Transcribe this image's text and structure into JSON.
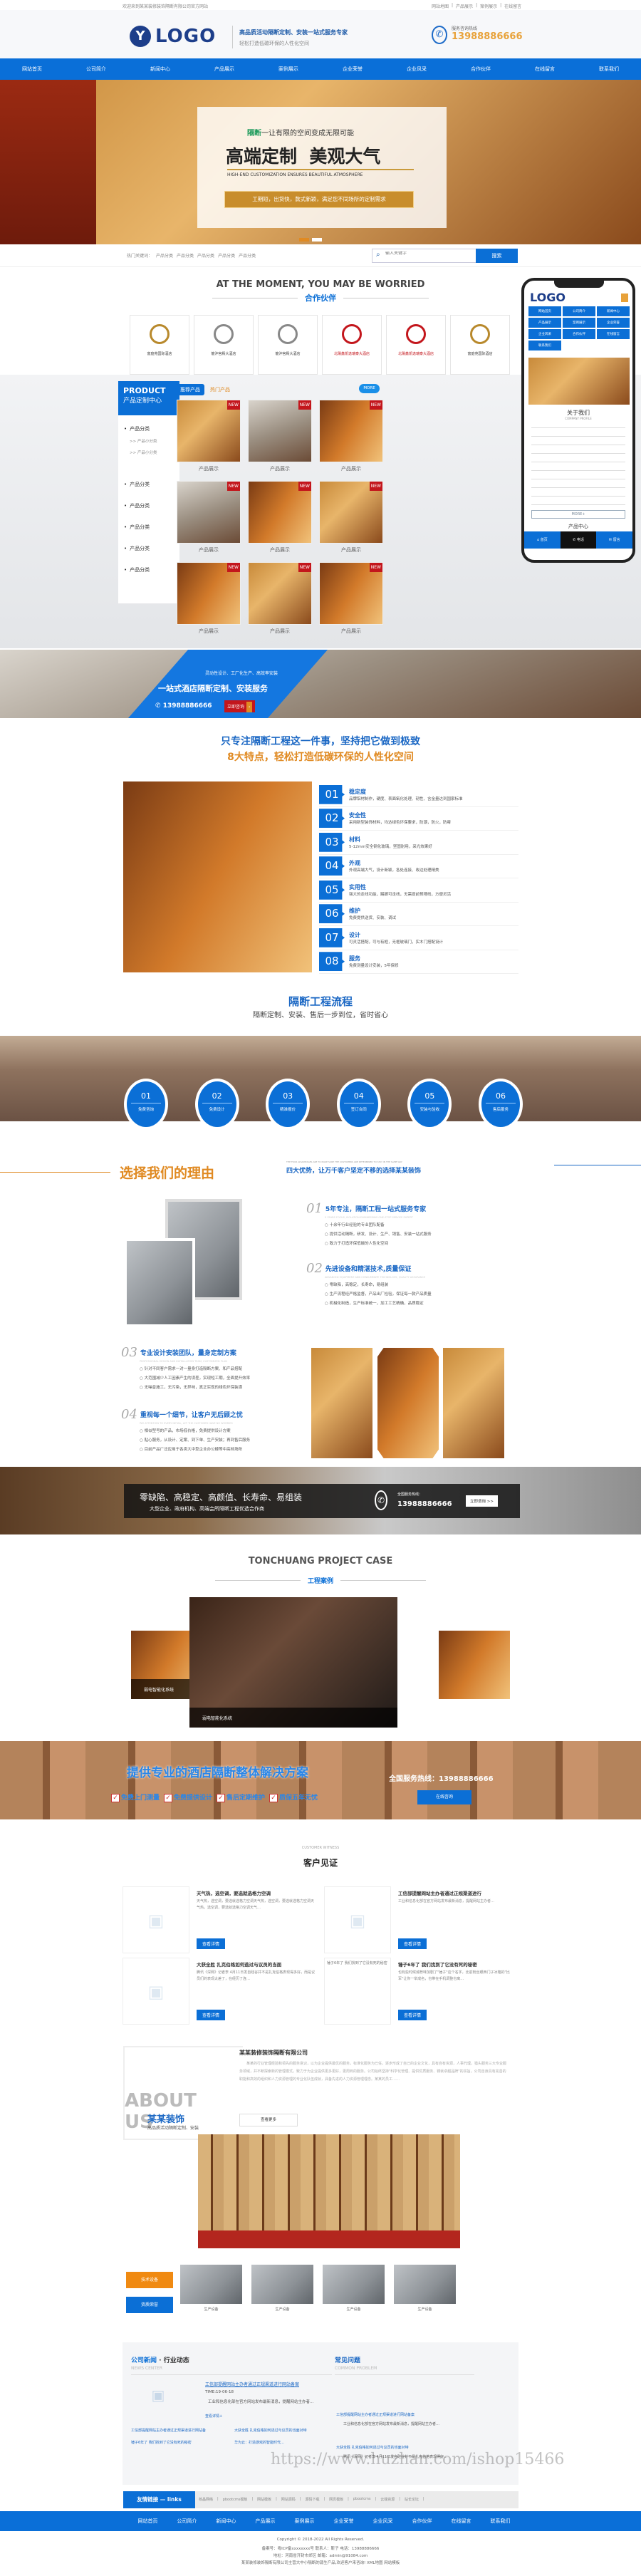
{
  "topbar": {
    "welcome": "欢迎来到某某装修装饰隔断有限公司官方网站",
    "links": [
      "网站地图",
      "产品展示",
      "案例展示",
      "在线留言"
    ]
  },
  "header": {
    "logo": "LOGO",
    "slogan": "高品质活动隔断定制、安装一站式服务专家",
    "sub": "轻松打造低碳环保的人性化空间",
    "hotline_label": "服务咨询热线",
    "phone": "13988886666"
  },
  "nav": [
    "网站首页",
    "公司简介",
    "新闻中心",
    "产品展示",
    "案例展示",
    "企业荣誉",
    "企业风采",
    "合作伙伴",
    "在线留言",
    "联系我们"
  ],
  "banner": {
    "kicker_em": "隔断",
    "kicker": "一让有限的空间变成无限可能",
    "headline": "高端定制  美观大气",
    "en": "HIGH-END CUSTOMIZATION ENSURES BEAUTIFUL ATMOSPHERE",
    "tag": "工期短，出货快，款式新颖，满足您不同场所的定制需求"
  },
  "search": {
    "hot_label": "热门关键词：",
    "keywords": [
      "产品分类",
      "产品分类",
      "产品分类",
      "产品分类",
      "产品分类"
    ],
    "placeholder": "输入关键字",
    "button": "搜索"
  },
  "partners": {
    "title": "AT THE MOMENT, YOU MAY BE WORRIED",
    "subtitle": "合作伙伴",
    "items": [
      {
        "name": "富庭苑国际酒店",
        "label": "合作伙伴"
      },
      {
        "name": "龍沖宮殿大酒店",
        "label": "合作伙伴"
      },
      {
        "name": "龍沖宮殿大酒店",
        "label": "合作伙伴"
      },
      {
        "name": "北陽鑫凯逸瑞泰大酒店",
        "label": "合作伙伴"
      },
      {
        "name": "北陽鑫凯逸瑞泰大酒店",
        "label": "合作伙伴"
      },
      {
        "name": "富庭苑国际酒店",
        "label": "合作伙伴"
      }
    ]
  },
  "products": {
    "side_en": "PRODUCT",
    "side_cn": "产品定制中心",
    "categories": [
      {
        "name": "产品分类",
        "subs": [
          "产品小分类",
          "产品小分类"
        ]
      },
      {
        "name": "产品分类",
        "subs": []
      },
      {
        "name": "产品分类",
        "subs": []
      },
      {
        "name": "产品分类",
        "subs": []
      },
      {
        "name": "产品分类",
        "subs": []
      },
      {
        "name": "产品分类",
        "subs": []
      }
    ],
    "tabs": [
      "推荐产品",
      "热门产品"
    ],
    "more": "MORE",
    "badge": "NEW",
    "items": [
      "产品展示",
      "产品展示",
      "产品展示",
      "产品展示",
      "产品展示",
      "产品展示",
      "产品展示",
      "产品展示",
      "产品展示"
    ]
  },
  "phone_mock": {
    "logo": "LOGO",
    "menu": [
      "网站首页",
      "公司简介",
      "新闻中心",
      "产品展示",
      "案例展示",
      "企业荣誉",
      "企业风采",
      "合作伙伴",
      "在线留言",
      "联系我们"
    ],
    "about": "关于我们",
    "about_en": "COMPANY PROFILE",
    "more": "MORE+",
    "products": "产品中心",
    "tabbar": [
      "首页",
      "电话",
      "留言"
    ]
  },
  "promo": {
    "line1": "灵动性设计、工厂化生产、高效率安装",
    "line2": "一站式酒店隔断定制、安装服务",
    "phone": "13988886666",
    "button": "立即咨询"
  },
  "features": {
    "title": "只专注隔断工程这一件事，坚持把它做到极致",
    "subtitle": "8大特点，轻松打造低碳环保的人性化空间",
    "items": [
      {
        "no": "01",
        "name": "稳定度",
        "desc": "品牌铝材制作，硬度、表面氧化处理、韧性、含金量达到国家标准"
      },
      {
        "no": "02",
        "name": "安全性",
        "desc": "采用新型装饰材料，均达绿色环保要求，防潮，防火，防霉"
      },
      {
        "no": "03",
        "name": "材料",
        "desc": "5-12mm安全钢化玻璃，坚固耐用，采光效果好"
      },
      {
        "no": "04",
        "name": "外观",
        "desc": "外观高端大气，设计新颖，各处连接、收边处理精美"
      },
      {
        "no": "05",
        "name": "实用性",
        "desc": "强大的走线功能，踢脚可走线，无需提前预埋线，方便灵活"
      },
      {
        "no": "06",
        "name": "维护",
        "desc": "免费提供送货、安装、调试"
      },
      {
        "no": "07",
        "name": "设计",
        "desc": "可灵活搭配，可与有框，无框玻璃门，实木门搭配设计"
      },
      {
        "no": "08",
        "name": "服务",
        "desc": "免费测量设计安装，5年保修"
      }
    ]
  },
  "process": {
    "title": "隔断工程流程",
    "subtitle": "隔断定制、安装、售后一步到位，省时省心",
    "steps": [
      {
        "no": "01",
        "name": "免费咨询"
      },
      {
        "no": "02",
        "name": "免费设计"
      },
      {
        "no": "03",
        "name": "精准报价"
      },
      {
        "no": "04",
        "name": "签订合同"
      },
      {
        "no": "05",
        "name": "安装与验收"
      },
      {
        "no": "06",
        "name": "售后服务"
      }
    ]
  },
  "reasons": {
    "title": "选择我们的理由",
    "en": "THE FOUR ADVANTAGES ARE TO MAKE SURE THE CUSTOMERS ARE DETERMINED TO STAY IN THE SAME WAY",
    "subtitle": "四大优势，让万千客户坚定不移的选择某某装饰",
    "items": [
      {
        "no": "01",
        "title": "5年专注，隔断工程一站式服务专家",
        "en": "5 YEARS FOCUS, ISOLATION ENGINEERING ONE-STOP SERVICE EXPERT",
        "points": [
          "十余年行业经验的专业团队配备",
          "提供活动隔断，研发、设计、生产、销售、安装一站式服务",
          "致力于打造环保低碳的人性化空间"
        ]
      },
      {
        "no": "02",
        "title": "先进设备和精湛技术,质量保证",
        "en": "ADVANCED EQUIPMENT AND CONSUMMATE TECHNOLOGY, QUALITY ASSURANCE",
        "points": [
          "零缺陷，高稳定，长寿命，易组装",
          "生产流程经严格监督，产品出厂检验，保证每一款产品质量",
          "机械化制造，生产标准统一，加工工艺精确，品质稳定"
        ]
      },
      {
        "no": "03",
        "title": "专业设计安装团队，量身定制方案",
        "en": "PROFESSIONAL DESIGN AND INSTALLATION TEAM, CUSTOMIZED PLAN",
        "points": [
          "针对不同客户需求一对一量身打造隔断方案、和产品搭配",
          "大范围减少人工因素产生的误差，实现短工期，全面提升效率",
          "无噪音施工，无污染，无异味，真正实现的绿色环保装潢"
        ]
      },
      {
        "no": "04",
        "title": "重视每一个细节，让客户无后顾之忧",
        "en": "PAY ATTENTION TO EVERY DETAIL, LET THE CUSTOMER HAVE NO WORRIES",
        "points": [
          "相似型号的产品，市场低价格，免费提供设计方案",
          "贴心服务，从设计、定案、到下单、生产安装；再到售后服务",
          "目前产品广泛应用于各类大中型企业办公楼等中高档场所"
        ]
      }
    ]
  },
  "dark_banner": {
    "line1": "零缺陷、高稳定、高颜值、长寿命、易组装",
    "line2": "大型企业、政府机构、高端会所隔断工程优选合作商",
    "hotline_label": "全国服务热线：",
    "phone": "13988886666",
    "button": "立即咨询 >>"
  },
  "cases": {
    "title": "TONCHUANG PROJECT CASE",
    "subtitle": "工程案例",
    "items": [
      "弱电智能化系统",
      "弱电智能化系统"
    ]
  },
  "solution": {
    "title": "提供专业的酒店隔断整体解决方案",
    "hotline": "全国服务热线：13988886666",
    "checks": [
      "免费上门测量",
      "免费提供设计",
      "售后定期维护",
      "质保五年无忧"
    ],
    "button": "在线咨询"
  },
  "witness": {
    "en": "CUSTOMER WITNESS",
    "title": "客户见证",
    "button": "查看详情",
    "items": [
      {
        "title": "天气热，选空调，要选就选格力空调",
        "desc": "天气热，选空调，要选就选格力空调天气热，选空调，要选就选格力空调天气热，选空调，要选就选格力空调天气…"
      },
      {
        "title": "工信部提醒网站主办者通过正规渠道进行",
        "desc": "工业和信息化部在官方网站发布最新消息，提醒网站主办者…"
      },
      {
        "title": "大获全胜 扎克伯格如何逃过与议员的当面",
        "desc": "腾讯《深网》记者李 4月11日发自硅谷并不是扎克伯格表现得多好，而是议员们的表现太差了，在经历了连…"
      },
      {
        "title": "锤子6年了 我们找到了它没有死的秘密",
        "desc": "也有些时候诚荐味加剧了\"锤子\"这个名字，比前粉丝眼西门子冰箱的\"比军\"让你一举成名，也带在手机调整也离…",
        "img_alt": "锤子6年了 我们找到了它没有死的秘密"
      }
    ]
  },
  "about": {
    "big": "ABOUT",
    "big2": "US",
    "brand": "某某装饰",
    "tagline": "高品质活动隔断定制、安装",
    "company": "某某装修装饰隔断有限公司",
    "text": "某某的行业管理经验和领先的服务意识，以为企业提供最优的服务，标准化服务为已任，逐步形成了自己的企业文化，具有自有资源，人事代理，猎头服务三大专业服务领域，并不断探索新的管理模式，致力于为企业提供更多更好，更周到的服务。公司始终坚持\"科学化管理、提供优质服务、铸就卓越品牌\"的宗旨，公司自身具有完善的职能和高效的组织和人力资源管理的专业化队伍成就，具备先进的人力资源管理理念。某某的员工……",
    "more": "查看更多",
    "side_buttons": [
      "技术设备",
      "资质荣誉"
    ],
    "equipment": [
      "生产设备",
      "生产设备",
      "生产设备",
      "生产设备"
    ]
  },
  "news": {
    "tab_active": "公司新闻",
    "dot": "·",
    "tab2": "行业动态",
    "en": "NEWS CENTER",
    "featured": {
      "title": "工信部提醒网站主办者通过正规渠道进行网站备案",
      "time": "TIME:19-06-18",
      "desc": "工业和信息化部在官方网站发布最新消息，提醒网站主办者…",
      "more": "查看详情+"
    },
    "list": [
      "工信部提醒网站主办者通过正规渠道进行网站备",
      "大获全胜 扎克伯格如何逃过与议员的当面对峙",
      "锤子6年了 我们找到了它没有死的秘密",
      "华为云：打造游戏的智能时代…"
    ],
    "faq_title": "常见问题",
    "faq_en": "COMMON PROBLEM",
    "faq": [
      {
        "q": "工信部提醒网站主办者通过正规渠道进行网站备案",
        "a": "工业和信息化部在官方网站发布最新消息，提醒网站主办者…"
      },
      {
        "q": "大获全胜 扎克伯格如何逃过与议员的当面对峙",
        "a": "腾讯《深网》记者李 4月11日发自硅谷并不是扎克伯格表现得好…"
      }
    ]
  },
  "links": {
    "label": "友情链接 — links",
    "items": [
      "核晶网络",
      "pbootcms模板",
      "网站模板",
      "网站源码",
      "源码下载",
      "网页模板",
      "pbootcms",
      "云端资源",
      "站长论坛"
    ]
  },
  "footer": {
    "copyright": "Copyright © 2018-2022 All Rights Reserved.",
    "icp": "备案号：粤ICP备xxxxxxxx号 联系人：靳子 电话：13988886666",
    "address": "地址：河南省开封市郊区   邮箱：admin@91084.com",
    "seo": "某某装修装饰隔断有限公司主营大中小隔断的源生产品,欢迎客户来咨询! XML地图 网站模板"
  },
  "watermark": "https://www.huzhan.com/ishop15466",
  "colors": {
    "primary": "#0b6fd6",
    "accent": "#e08a22",
    "badge": "#c3161c",
    "phone": "#e8a23a"
  }
}
